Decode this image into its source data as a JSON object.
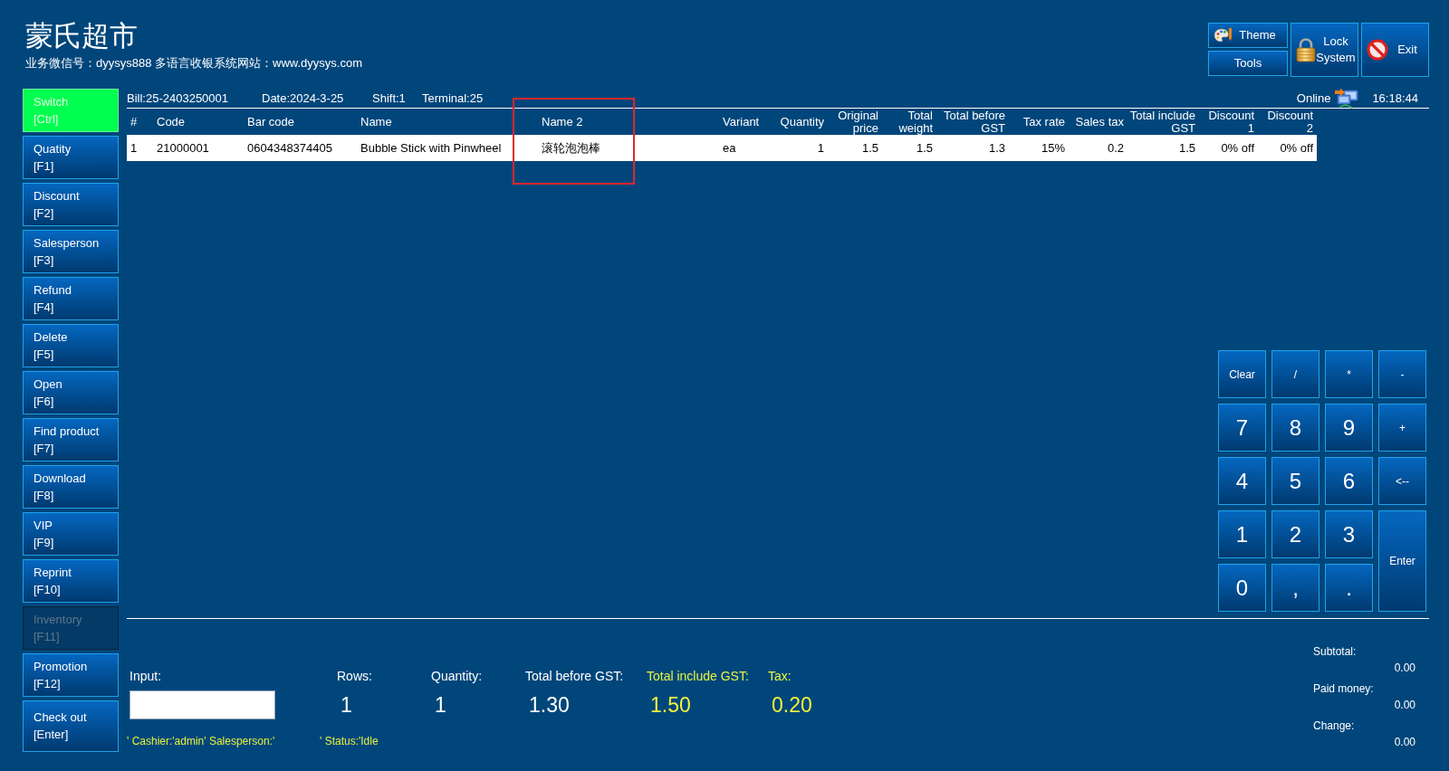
{
  "header": {
    "title": "蒙氏超市",
    "subtitle": "业务微信号：dyysys888 多语言收银系统网站：www.dyysys.com"
  },
  "toolbar": [
    {
      "kind": "theme",
      "label": "Theme"
    },
    {
      "kind": "tools",
      "label": "Tools"
    },
    {
      "kind": "lock",
      "label": "Lock System"
    },
    {
      "kind": "exit",
      "label": "Exit"
    }
  ],
  "bill_info": {
    "bill": "Bill:25-2403250001",
    "date": "Date:2024-3-25",
    "shift": "Shift:1",
    "terminal": "Terminal:25",
    "connection": "Online",
    "time": "16:18:44"
  },
  "sidebar": [
    {
      "label": "Switch",
      "shortcut": "[Ctrl]",
      "active": true,
      "disabled": false
    },
    {
      "label": "Quatity",
      "shortcut": "[F1]",
      "active": false,
      "disabled": false
    },
    {
      "label": "Discount",
      "shortcut": "[F2]",
      "active": false,
      "disabled": false
    },
    {
      "label": "Salesperson",
      "shortcut": "[F3]",
      "active": false,
      "disabled": false
    },
    {
      "label": "Refund",
      "shortcut": "[F4]",
      "active": false,
      "disabled": false
    },
    {
      "label": "Delete",
      "shortcut": "[F5]",
      "active": false,
      "disabled": false
    },
    {
      "label": "Open",
      "shortcut": "[F6]",
      "active": false,
      "disabled": false
    },
    {
      "label": "Find product",
      "shortcut": "[F7]",
      "active": false,
      "disabled": false
    },
    {
      "label": "Download",
      "shortcut": "[F8]",
      "active": false,
      "disabled": false
    },
    {
      "label": "VIP",
      "shortcut": "[F9]",
      "active": false,
      "disabled": false
    },
    {
      "label": "Reprint",
      "shortcut": "[F10]",
      "active": false,
      "disabled": false
    },
    {
      "label": "Inventory",
      "shortcut": "[F11]",
      "active": false,
      "disabled": true
    },
    {
      "label": "Promotion",
      "shortcut": "[F12]",
      "active": false,
      "disabled": false
    },
    {
      "label": "Check out",
      "shortcut": "[Enter]",
      "active": false,
      "disabled": false
    }
  ],
  "table": {
    "columns": [
      {
        "label": "#",
        "highlighted": false
      },
      {
        "label": "Code",
        "highlighted": false
      },
      {
        "label": "Bar code",
        "highlighted": false
      },
      {
        "label": "Name",
        "highlighted": false
      },
      {
        "label": "Name 2",
        "highlighted": true
      },
      {
        "label": "Variant",
        "highlighted": false
      },
      {
        "label": "Quantity",
        "highlighted": false
      },
      {
        "label": "Original price",
        "highlighted": false
      },
      {
        "label": "Total weight",
        "highlighted": false
      },
      {
        "label": "Total before GST",
        "highlighted": false
      },
      {
        "label": "Tax rate",
        "highlighted": false
      },
      {
        "label": "Sales tax",
        "highlighted": false
      },
      {
        "label": "Total include GST",
        "highlighted": false
      },
      {
        "label": "Discount 1",
        "highlighted": false
      },
      {
        "label": "Discount 2",
        "highlighted": false
      }
    ],
    "rows": [
      {
        "cells": [
          "1",
          "21000001",
          "0604348374405",
          "Bubble Stick with Pinwheel",
          "滚轮泡泡棒",
          "ea",
          "1",
          "1.5",
          "1.5",
          "1.3",
          "15%",
          "0.2",
          "1.5",
          "0% off",
          "0% off"
        ]
      }
    ]
  },
  "keypad": [
    {
      "label": "Clear",
      "kind": "command"
    },
    {
      "label": "/",
      "kind": "command"
    },
    {
      "label": "*",
      "kind": "command"
    },
    {
      "label": "-",
      "kind": "command"
    },
    {
      "label": "7",
      "kind": "digit"
    },
    {
      "label": "8",
      "kind": "digit"
    },
    {
      "label": "9",
      "kind": "digit"
    },
    {
      "label": "+",
      "kind": "command"
    },
    {
      "label": "4",
      "kind": "digit"
    },
    {
      "label": "5",
      "kind": "digit"
    },
    {
      "label": "6",
      "kind": "digit"
    },
    {
      "label": "<--",
      "kind": "command"
    },
    {
      "label": "1",
      "kind": "digit"
    },
    {
      "label": "2",
      "kind": "digit"
    },
    {
      "label": "3",
      "kind": "digit"
    },
    {
      "label": "Enter",
      "kind": "enter"
    },
    {
      "label": "0",
      "kind": "digit"
    },
    {
      "label": ",",
      "kind": "digit"
    },
    {
      "label": ".",
      "kind": "digit"
    }
  ],
  "entry": {
    "input": {
      "label": "Input:"
    },
    "fields": [
      {
        "label": "Rows:",
        "value": "1",
        "highlighted": false
      },
      {
        "label": "Quantity:",
        "value": "1",
        "highlighted": false
      },
      {
        "label": "Total before GST:",
        "value": "1.30",
        "highlighted": false
      },
      {
        "label": "Total include GST:",
        "value": "1.50",
        "highlighted": true
      },
      {
        "label": "Tax:",
        "value": "0.20",
        "highlighted": true
      }
    ],
    "status": [
      "' Cashier:'admin' Salesperson:'",
      "' Status:'Idle"
    ]
  },
  "summary": [
    {
      "label": "Subtotal:",
      "value": "0.00"
    },
    {
      "label": "Paid money:",
      "value": "0.00"
    },
    {
      "label": "Change:",
      "value": "0.00"
    }
  ]
}
